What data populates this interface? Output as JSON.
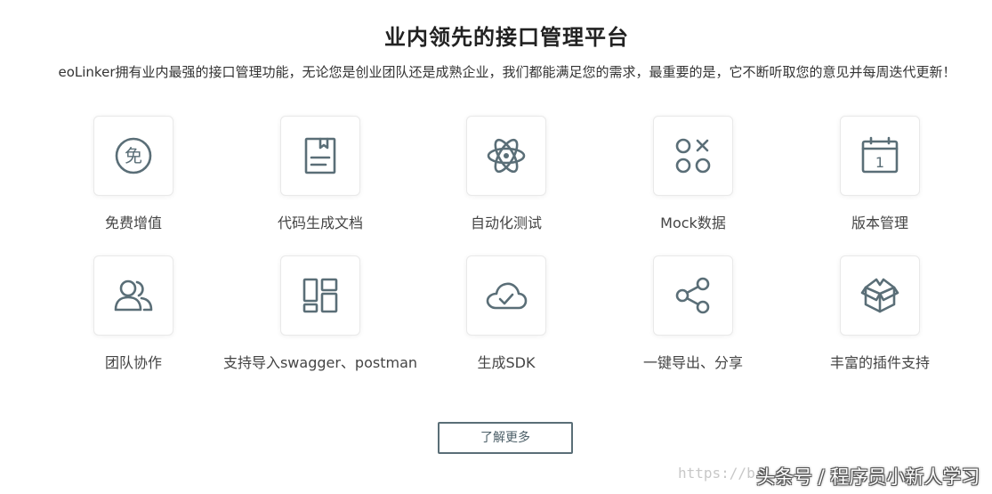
{
  "header": {
    "title": "业内领先的接口管理平台",
    "subtitle": "eoLinker拥有业内最强的接口管理功能，无论您是创业团队还是成熟企业，我们都能满足您的需求，最重要的是，它不断听取您的意见并每周迭代更新！"
  },
  "features": [
    {
      "label": "免费增值",
      "icon": "free-icon",
      "icon_glyph": "免"
    },
    {
      "label": "代码生成文档",
      "icon": "document-icon"
    },
    {
      "label": "自动化测试",
      "icon": "atom-icon"
    },
    {
      "label": "Mock数据",
      "icon": "shapes-icon"
    },
    {
      "label": "版本管理",
      "icon": "calendar-icon",
      "icon_glyph": "1"
    },
    {
      "label": "团队协作",
      "icon": "team-icon"
    },
    {
      "label": "支持导入swagger、postman",
      "icon": "layout-icon"
    },
    {
      "label": "生成SDK",
      "icon": "cloud-check-icon"
    },
    {
      "label": "一键导出、分享",
      "icon": "share-icon"
    },
    {
      "label": "丰富的插件支持",
      "icon": "box-icon"
    }
  ],
  "cta": {
    "label": "了解更多"
  },
  "watermark": {
    "url": "https://b",
    "brand": "头条号 / 程序员小新人学习"
  },
  "colors": {
    "icon": "#5a6e77",
    "border": "#e9e9e9",
    "text": "#444444"
  }
}
